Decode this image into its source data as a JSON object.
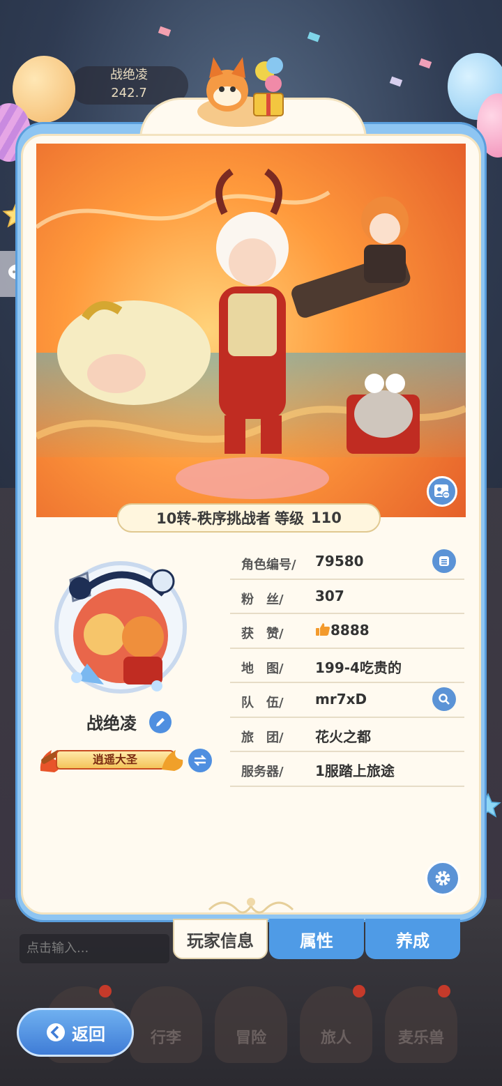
{
  "background": {
    "ghost_name": "战绝凌",
    "ghost_value": "242.7"
  },
  "header": {
    "class_title": "10转-秩序挑战者",
    "level_label": "等级",
    "level_value": "110"
  },
  "profile": {
    "name": "战绝凌",
    "title_badge": "逍遥大圣"
  },
  "info_rows": [
    {
      "key": "角色编号/",
      "value": "79580",
      "icon": "copy-icon"
    },
    {
      "key": "粉　丝/",
      "value": "307"
    },
    {
      "key": "获　赞/",
      "value": "8888",
      "icon": "thumbs-up-icon"
    },
    {
      "key": "地　图/",
      "value": "199-4吃贵的"
    },
    {
      "key": "队　伍/",
      "value": "mr7xD",
      "icon": "search-icon"
    },
    {
      "key": "旅　团/",
      "value": "花火之都"
    },
    {
      "key": "服务器/",
      "value": "1服踏上旅途"
    }
  ],
  "tabs": [
    {
      "label": "玩家信息",
      "active": true
    },
    {
      "label": "属性",
      "active": false
    },
    {
      "label": "养成",
      "active": false
    }
  ],
  "chat": {
    "placeholder": "点击输入..."
  },
  "bottom_nav": [
    {
      "label": "",
      "badge": true
    },
    {
      "label": "行李",
      "badge": false
    },
    {
      "label": "冒险",
      "badge": false
    },
    {
      "label": "旅人",
      "badge": true
    },
    {
      "label": "麦乐兽",
      "badge": true
    }
  ],
  "back_button": {
    "label": "返回"
  },
  "colors": {
    "accent_blue": "#4f9be6",
    "card_bg": "#fffaf0",
    "thumb_orange": "#f39a2c"
  }
}
